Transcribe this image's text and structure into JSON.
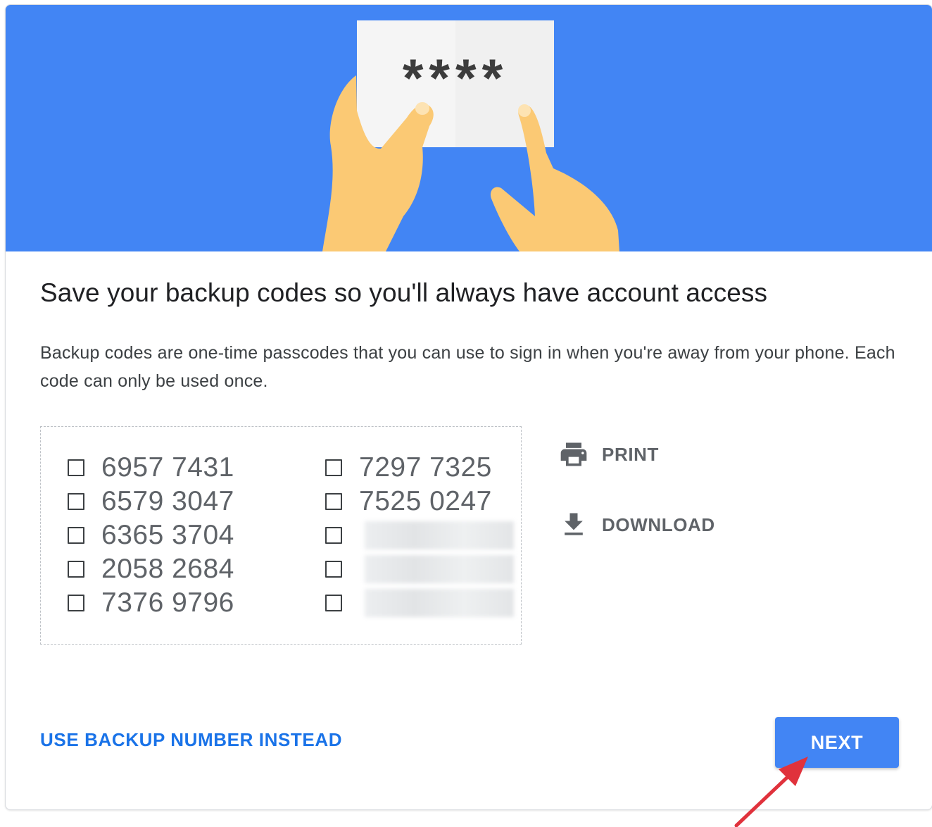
{
  "hero": {
    "masked_text": "****",
    "colors": {
      "background": "#4285f4",
      "paper": "#f3f3f3",
      "skin": "#fbc974"
    }
  },
  "title": "Save your backup codes so you'll always have account access",
  "description": "Backup codes are one-time passcodes that you can use to sign in when you're away from your phone. Each code can only be used once.",
  "codes": {
    "left": [
      "6957 7431",
      "6579 3047",
      "6365 3704",
      "2058 2684",
      "7376 9796"
    ],
    "right": [
      "7297 7325",
      "7525 0247"
    ],
    "right_hidden_count": 3
  },
  "actions": {
    "print": {
      "label": "PRINT",
      "icon": "printer-icon"
    },
    "download": {
      "label": "DOWNLOAD",
      "icon": "download-icon"
    }
  },
  "footer": {
    "alt_link": "USE BACKUP NUMBER INSTEAD",
    "next_label": "NEXT"
  },
  "colors": {
    "accent": "#4285f4",
    "link": "#1a73e8",
    "annotation_arrow": "#e0323c"
  }
}
